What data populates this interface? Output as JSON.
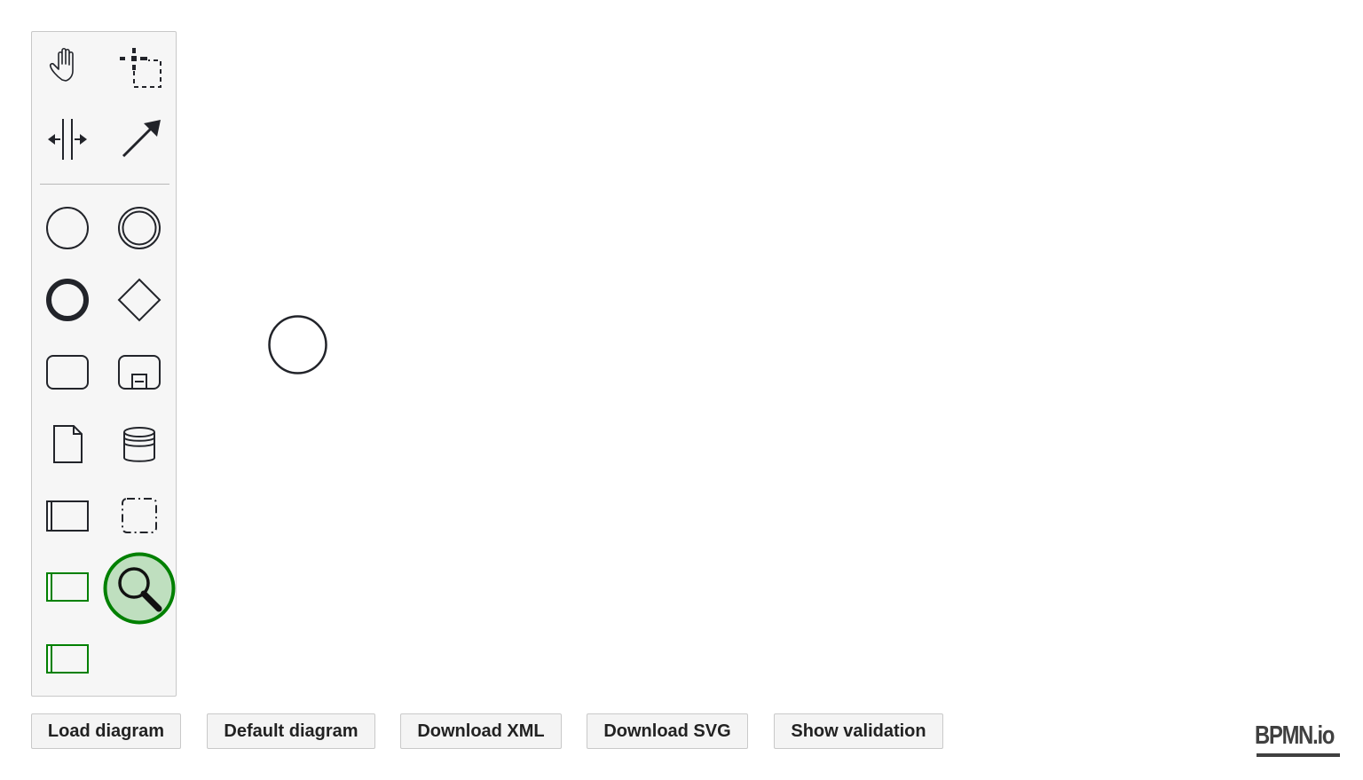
{
  "palette": {
    "tools": [
      {
        "icon": "hand-tool-icon"
      },
      {
        "icon": "lasso-tool-icon"
      },
      {
        "icon": "space-tool-icon"
      },
      {
        "icon": "global-connect-tool-icon"
      },
      {
        "icon": "start-event-icon"
      },
      {
        "icon": "intermediate-event-icon"
      },
      {
        "icon": "end-event-icon"
      },
      {
        "icon": "gateway-icon"
      },
      {
        "icon": "task-icon"
      },
      {
        "icon": "subprocess-icon"
      },
      {
        "icon": "data-object-icon"
      },
      {
        "icon": "data-store-icon"
      },
      {
        "icon": "participant-icon"
      },
      {
        "icon": "group-icon"
      },
      {
        "icon": "custom-green-pool-icon"
      },
      {
        "icon": "magnifier-search-icon"
      },
      {
        "icon": "custom-green-pool-icon"
      }
    ]
  },
  "buttons": {
    "load": "Load diagram",
    "default": "Default diagram",
    "download_xml": "Download XML",
    "download_svg": "Download SVG",
    "show_validation": "Show validation"
  },
  "logo": {
    "text": "BPMN.io"
  },
  "colors": {
    "stroke": "#22242a",
    "green": "#008000",
    "green_fill": "#bfdfbf",
    "palette_bg": "#f6f6f6"
  }
}
